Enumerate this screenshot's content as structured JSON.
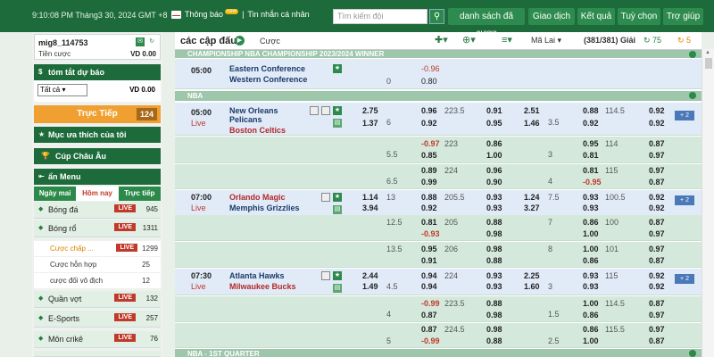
{
  "topbar": {
    "datetime": "9:10:08 PM Tháng3 30, 2024 GMT +8",
    "notice": "Thông báo",
    "notice_badge": "new",
    "personal_msg": "Tin nhắn cá nhân",
    "search_placeholder": "Tìm kiếm đội",
    "nav": [
      "danh sách đã cược",
      "Giao dịch",
      "Kết quả",
      "Tuỳ chọn",
      "Trợ giúp"
    ]
  },
  "user": {
    "name": "mig8_114753",
    "balance_label": "Tiền cược",
    "balance_value": "VD 0.00"
  },
  "sidebar": {
    "summary_title": "tóm tắt dự báo",
    "filter_selected": "Tất cả",
    "filter_value": "VD 0.00",
    "live_label": "Trực Tiếp",
    "live_count": "124",
    "favorites": "Mục ưa thích của tôi",
    "euro_cup": "Cúp Châu Âu",
    "menu_title": "ẩn Menu",
    "tabs": [
      "Ngày mai",
      "Hôm nay",
      "Trực tiếp"
    ],
    "sports": [
      {
        "name": "Bóng đá",
        "live": "LIVE",
        "count": "945"
      },
      {
        "name": "Bóng rổ",
        "live": "LIVE",
        "count": "1311"
      }
    ],
    "sub_items": [
      {
        "name": "Cược chấp ...",
        "live": "LIVE",
        "count": "1299"
      },
      {
        "name": "Cược hỗn hợp",
        "count": "25"
      },
      {
        "name": "cược đối vô địch",
        "count": "12"
      }
    ],
    "more_sports": [
      {
        "name": "Quần vợt",
        "live": "LIVE",
        "count": "132"
      },
      {
        "name": "E-Sports",
        "live": "LIVE",
        "count": "257"
      },
      {
        "name": "Môn crikê",
        "live": "LIVE",
        "count": "76"
      }
    ]
  },
  "main": {
    "title": "các cập đấu",
    "cuoc": "Cược",
    "odds_type": "Mã Lai",
    "count": "(381/381) Giải",
    "n75": "75",
    "n5": "5",
    "league_top": "CHAMPIONSHIP NBA CHAMPIONSHIP 2023/2024 WINNER",
    "league_nba": "NBA",
    "league_q1": "NBA - 1ST QUARTER",
    "match0": {
      "time": "05:00",
      "home": "Eastern Conference",
      "away": "Western Conference",
      "hdp": "0",
      "o1": "-0.96",
      "o2": "0.80"
    },
    "m1": {
      "time": "05:00",
      "live": "Live",
      "home": "New Orleans Pelicans",
      "home2": "",
      "away": "Boston Celtics",
      "r1": {
        "ml1": "2.75",
        "ml2": "1.37",
        "h": "6",
        "hd1": "0.96",
        "hd2": "0.92",
        "ou": "223.5",
        "ou1": "0.91",
        "ou2": "0.95",
        "fml1": "2.51",
        "fml2": "1.46",
        "fh": "3.5",
        "fh1": "0.88",
        "fh2": "0.92",
        "fou": "114.5",
        "fo1": "0.92",
        "fo2": "0.92",
        "more": "2"
      },
      "r2": {
        "h": "5.5",
        "hd1": "-0.97",
        "hd2": "0.85",
        "ou": "223",
        "ou1": "0.86",
        "ou2": "1.00",
        "fh": "3",
        "fh1": "0.95",
        "fh2": "0.81",
        "fou": "114",
        "fo1": "0.87",
        "fo2": "0.97"
      },
      "r3": {
        "h": "6.5",
        "hd1": "0.89",
        "hd2": "0.99",
        "ou": "224",
        "ou1": "0.96",
        "ou2": "0.90",
        "fh": "4",
        "fh1": "0.81",
        "fh2": "-0.95",
        "fou": "115",
        "fo1": "0.97",
        "fo2": "0.87"
      }
    },
    "m2": {
      "time": "07:00",
      "live": "Live",
      "home": "Orlando Magic",
      "away": "Memphis Grizzlies",
      "r1": {
        "ml1": "1.14",
        "ml2": "3.94",
        "h": "13",
        "hd1": "0.88",
        "hd2": "0.92",
        "ou": "205.5",
        "ou1": "0.93",
        "ou2": "0.93",
        "fml1": "1.24",
        "fml2": "3.27",
        "fh": "7.5",
        "fh1": "0.93",
        "fh2": "0.93",
        "fou": "100.5",
        "fo1": "0.92",
        "fo2": "0.92",
        "more": "2"
      },
      "r2": {
        "h": "12.5",
        "hd1": "0.81",
        "hd2": "-0.93",
        "ou": "205",
        "ou1": "0.88",
        "ou2": "0.98",
        "fh": "7",
        "fh1": "0.86",
        "fh2": "1.00",
        "fou": "100",
        "fo1": "0.87",
        "fo2": "0.97"
      },
      "r3": {
        "h": "13.5",
        "hd1": "0.95",
        "hd2": "0.91",
        "ou": "206",
        "ou1": "0.98",
        "ou2": "0.88",
        "fh": "8",
        "fh1": "1.00",
        "fh2": "0.86",
        "fou": "101",
        "fo1": "0.97",
        "fo2": "0.87"
      }
    },
    "m3": {
      "time": "07:30",
      "live": "Live",
      "home": "Atlanta Hawks",
      "away": "Milwaukee Bucks",
      "r1": {
        "ml1": "2.44",
        "ml2": "1.49",
        "h": "4.5",
        "hd1": "0.94",
        "hd2": "0.94",
        "ou": "224",
        "ou1": "0.93",
        "ou2": "0.93",
        "fml1": "2.25",
        "fml2": "1.60",
        "fh": "3",
        "fh1": "0.93",
        "fh2": "0.93",
        "fou": "115",
        "fo1": "0.92",
        "fo2": "0.92",
        "more": "2"
      },
      "r2": {
        "h": "4",
        "hd1": "-0.99",
        "hd2": "0.87",
        "ou": "223.5",
        "ou1": "0.88",
        "ou2": "0.98",
        "fh": "1.5",
        "fh1": "1.00",
        "fh2": "0.86",
        "fou": "114.5",
        "fo1": "0.87",
        "fo2": "0.97"
      },
      "r3": {
        "h": "5",
        "hd1": "0.87",
        "hd2": "-0.99",
        "ou": "224.5",
        "ou1": "0.98",
        "ou2": "0.88",
        "fh": "2.5",
        "fh1": "0.86",
        "fh2": "1.00",
        "fou": "115.5",
        "fo1": "0.97",
        "fo2": "0.87"
      }
    }
  }
}
